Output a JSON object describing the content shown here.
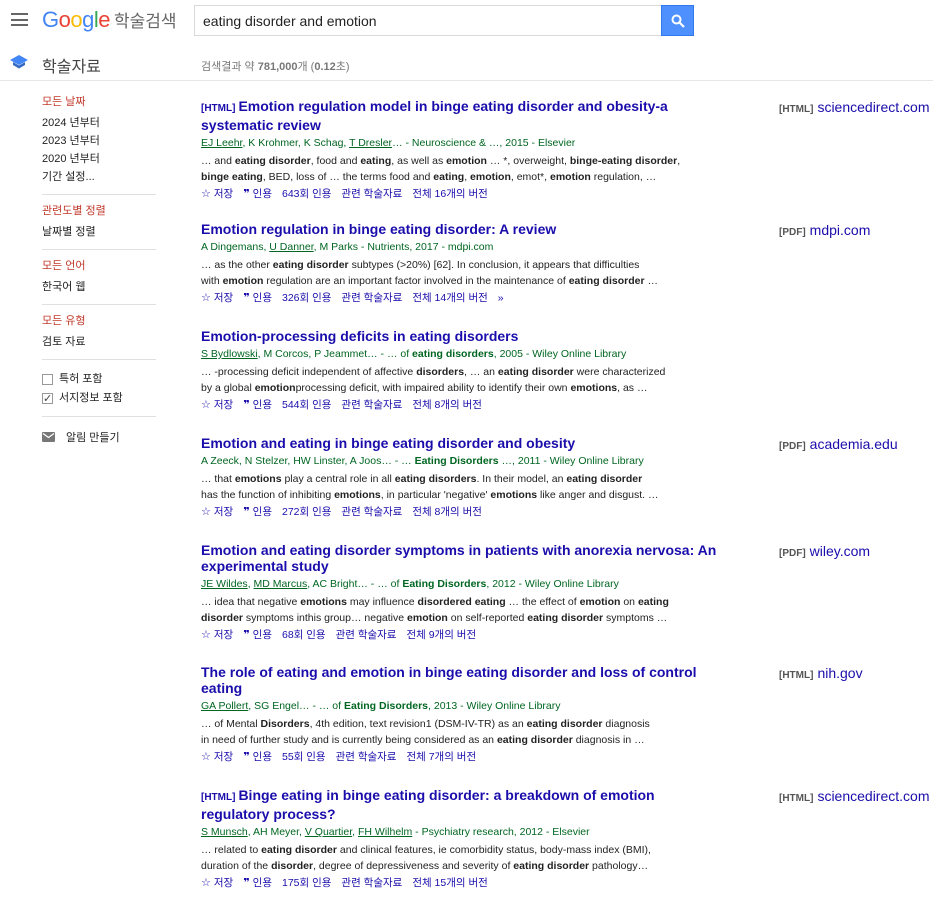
{
  "header": {
    "logo_g": "G",
    "logo_o1": "o",
    "logo_o2": "o",
    "logo_g2": "g",
    "logo_l": "l",
    "logo_e": "e",
    "logo_sub": "학술검색",
    "search_value": "eating disorder and emotion",
    "menu_icon": "hamburger-menu-icon",
    "search_icon": "search-icon",
    "colors": {
      "search_button": "#4d90fe",
      "link": "#1a0dab",
      "source": "#006621",
      "filter_head": "#c0392b"
    }
  },
  "subheader": {
    "title": "학술자료",
    "count_prefix": "검색결과 약 ",
    "count_value": "781,000",
    "count_mid": "개 (",
    "count_time": "0.12",
    "count_suffix": "초)"
  },
  "sidebar": {
    "date_head": "모든 날짜",
    "dates": [
      "2024 년부터",
      "2023 년부터",
      "2020 년부터",
      "기간 설정..."
    ],
    "sort_head": "관련도별 정렬",
    "sort_alt": "날짜별 정렬",
    "lang_head": "모든 언어",
    "lang_alt": "한국어 웹",
    "type_head": "모든 유형",
    "type_alt": "검토 자료",
    "include_patents": "특허 포함",
    "include_citations": "서지정보 포함",
    "include_patents_checked": false,
    "include_citations_checked": true,
    "alert": "알림 만들기"
  },
  "link_labels": {
    "save": "저장",
    "cite": "인용",
    "related": "관련 학술자료"
  },
  "results": [
    {
      "tag": "[HTML]",
      "title": [
        [
          "b",
          "Emotion"
        ],
        [
          "t",
          " regulation model in "
        ],
        [
          "b",
          "binge eating disorder"
        ],
        [
          "t",
          " and obesity-a systematic review"
        ]
      ],
      "meta": [
        [
          "u",
          "EJ Leehr"
        ],
        [
          "t",
          ", K Krohmer, K Schag, "
        ],
        [
          "u",
          "T Dresler"
        ],
        [
          "t",
          "… - Neuroscience & …, 2015 - Elsevier"
        ]
      ],
      "snip1": [
        [
          "t",
          "… and "
        ],
        [
          "b",
          "eating disorder"
        ],
        [
          "t",
          ", food and "
        ],
        [
          "b",
          "eating"
        ],
        [
          "t",
          ", as well as "
        ],
        [
          "b",
          "emotion"
        ],
        [
          "t",
          " … *, overweight, "
        ],
        [
          "b",
          "binge-eating disorder"
        ],
        [
          "t",
          ","
        ]
      ],
      "snip2": [
        [
          "b",
          "binge eating"
        ],
        [
          "t",
          ", BED, loss of … the terms food and "
        ],
        [
          "b",
          "eating"
        ],
        [
          "t",
          ", "
        ],
        [
          "b",
          "emotion"
        ],
        [
          "t",
          ", emot*, "
        ],
        [
          "b",
          "emotion"
        ],
        [
          "t",
          " regulation, …"
        ]
      ],
      "cited": "643회 인용",
      "versions": "전체 16개의 버전",
      "extra": "",
      "side_type": "[HTML]",
      "side_domain": "sciencedirect.com"
    },
    {
      "tag": "",
      "title": [
        [
          "b",
          "Emotion"
        ],
        [
          "t",
          " regulation in "
        ],
        [
          "b",
          "binge eating disorder"
        ],
        [
          "t",
          ": A review"
        ]
      ],
      "meta": [
        [
          "t",
          "A Dingemans, "
        ],
        [
          "u",
          "U Danner"
        ],
        [
          "t",
          ", M Parks - Nutrients, 2017 - mdpi.com"
        ]
      ],
      "snip1": [
        [
          "t",
          "… as the other "
        ],
        [
          "b",
          "eating disorder"
        ],
        [
          "t",
          " subtypes (>20%) [62]. In conclusion, it appears that difficulties"
        ]
      ],
      "snip2": [
        [
          "t",
          "with "
        ],
        [
          "b",
          "emotion"
        ],
        [
          "t",
          " regulation are an important factor involved in the maintenance of "
        ],
        [
          "b",
          "eating disorder"
        ],
        [
          "t",
          " …"
        ]
      ],
      "cited": "326회 인용",
      "versions": "전체 14개의 버전",
      "extra": "»",
      "side_type": "[PDF]",
      "side_domain": "mdpi.com"
    },
    {
      "tag": "",
      "title": [
        [
          "b",
          "Emotion"
        ],
        [
          "t",
          "-processing deficits in "
        ],
        [
          "b",
          "eating disorders"
        ]
      ],
      "meta": [
        [
          "u",
          "S Bydlowski"
        ],
        [
          "t",
          ", M Corcos, P Jeammet… - … of "
        ],
        [
          "b",
          "eating disorders"
        ],
        [
          "t",
          ", 2005 - Wiley Online Library"
        ]
      ],
      "snip1": [
        [
          "t",
          "… -processing deficit independent of affective "
        ],
        [
          "b",
          "disorders"
        ],
        [
          "t",
          ", … an "
        ],
        [
          "b",
          "eating disorder"
        ],
        [
          "t",
          " were characterized"
        ]
      ],
      "snip2": [
        [
          "t",
          "by a global "
        ],
        [
          "b",
          "emotion"
        ],
        [
          "t",
          "processing deficit, with impaired ability to identify their own "
        ],
        [
          "b",
          "emotions"
        ],
        [
          "t",
          ", as …"
        ]
      ],
      "cited": "544회 인용",
      "versions": "전체 8개의 버전",
      "extra": "",
      "side_type": "",
      "side_domain": ""
    },
    {
      "tag": "",
      "title": [
        [
          "b",
          "Emotion"
        ],
        [
          "t",
          " and "
        ],
        [
          "b",
          "eating"
        ],
        [
          "t",
          " in "
        ],
        [
          "b",
          "binge eating disorder"
        ],
        [
          "t",
          " and obesity"
        ]
      ],
      "meta": [
        [
          "t",
          "A Zeeck, N Stelzer, HW Linster, A Joos… - … "
        ],
        [
          "b",
          "Eating Disorders"
        ],
        [
          "t",
          " …, 2011 - Wiley Online Library"
        ]
      ],
      "snip1": [
        [
          "t",
          "… that "
        ],
        [
          "b",
          "emotions"
        ],
        [
          "t",
          " play a central role in all "
        ],
        [
          "b",
          "eating disorders"
        ],
        [
          "t",
          ". In their model, an "
        ],
        [
          "b",
          "eating disorder"
        ]
      ],
      "snip2": [
        [
          "t",
          "has the function of inhibiting "
        ],
        [
          "b",
          "emotions"
        ],
        [
          "t",
          ", in particular 'negative' "
        ],
        [
          "b",
          "emotions"
        ],
        [
          "t",
          " like anger and disgust. …"
        ]
      ],
      "cited": "272회 인용",
      "versions": "전체 8개의 버전",
      "extra": "",
      "side_type": "[PDF]",
      "side_domain": "academia.edu"
    },
    {
      "tag": "",
      "title": [
        [
          "b",
          "Emotion"
        ],
        [
          "t",
          " and "
        ],
        [
          "b",
          "eating disorder"
        ],
        [
          "t",
          " symptoms in patients with anorexia nervosa: An experimental study"
        ]
      ],
      "meta": [
        [
          "u",
          "JE Wildes"
        ],
        [
          "t",
          ", "
        ],
        [
          "u",
          "MD Marcus"
        ],
        [
          "t",
          ", AC Bright… - … of "
        ],
        [
          "b",
          "Eating Disorders"
        ],
        [
          "t",
          ", 2012 - Wiley Online Library"
        ]
      ],
      "snip1": [
        [
          "t",
          "… idea that negative "
        ],
        [
          "b",
          "emotions"
        ],
        [
          "t",
          " may influence "
        ],
        [
          "b",
          "disordered eating"
        ],
        [
          "t",
          " … the effect of "
        ],
        [
          "b",
          "emotion"
        ],
        [
          "t",
          " on "
        ],
        [
          "b",
          "eating"
        ]
      ],
      "snip2": [
        [
          "b",
          "disorder"
        ],
        [
          "t",
          " symptoms inthis group… negative "
        ],
        [
          "b",
          "emotion"
        ],
        [
          "t",
          " on self-reported "
        ],
        [
          "b",
          "eating disorder"
        ],
        [
          "t",
          " symptoms …"
        ]
      ],
      "cited": "68회 인용",
      "versions": "전체 9개의 버전",
      "extra": "",
      "side_type": "[PDF]",
      "side_domain": "wiley.com"
    },
    {
      "tag": "",
      "title": [
        [
          "t",
          "The role of "
        ],
        [
          "b",
          "eating"
        ],
        [
          "t",
          " and "
        ],
        [
          "b",
          "emotion"
        ],
        [
          "t",
          " in "
        ],
        [
          "b",
          "binge eating disorder"
        ],
        [
          "t",
          " and loss of control "
        ],
        [
          "b",
          "eating"
        ]
      ],
      "meta": [
        [
          "u",
          "GA Pollert"
        ],
        [
          "t",
          ", SG Engel… - … of "
        ],
        [
          "b",
          "Eating Disorders"
        ],
        [
          "t",
          ", 2013 - Wiley Online Library"
        ]
      ],
      "snip1": [
        [
          "t",
          "… of Mental "
        ],
        [
          "b",
          "Disorders"
        ],
        [
          "t",
          ", 4th edition, text revision1 (DSM-IV-TR) as an "
        ],
        [
          "b",
          "eating disorder"
        ],
        [
          "t",
          " diagnosis"
        ]
      ],
      "snip2": [
        [
          "t",
          "in need of further study and is currently being considered as an "
        ],
        [
          "b",
          "eating disorder"
        ],
        [
          "t",
          " diagnosis in …"
        ]
      ],
      "cited": "55회 인용",
      "versions": "전체 7개의 버전",
      "extra": "",
      "side_type": "[HTML]",
      "side_domain": "nih.gov"
    },
    {
      "tag": "[HTML]",
      "title": [
        [
          "b",
          "Binge eating"
        ],
        [
          "t",
          " in "
        ],
        [
          "b",
          "binge eating disorder"
        ],
        [
          "t",
          ": a breakdown of "
        ],
        [
          "b",
          "emotion"
        ],
        [
          "t",
          " regulatory process?"
        ]
      ],
      "meta": [
        [
          "u",
          "S Munsch"
        ],
        [
          "t",
          ", AH Meyer, "
        ],
        [
          "u",
          "V Quartier"
        ],
        [
          "t",
          ", "
        ],
        [
          "u",
          "FH Wilhelm"
        ],
        [
          "t",
          " - Psychiatry research, 2012 - Elsevier"
        ]
      ],
      "snip1": [
        [
          "t",
          "… related to "
        ],
        [
          "b",
          "eating disorder"
        ],
        [
          "t",
          " and clinical features, ie comorbidity status, body-mass index (BMI),"
        ]
      ],
      "snip2": [
        [
          "t",
          "duration of the "
        ],
        [
          "b",
          "disorder"
        ],
        [
          "t",
          ", degree of depressiveness and severity of "
        ],
        [
          "b",
          "eating disorder"
        ],
        [
          "t",
          " pathology…"
        ]
      ],
      "cited": "175회 인용",
      "versions": "전체 15개의 버전",
      "extra": "",
      "side_type": "[HTML]",
      "side_domain": "sciencedirect.com"
    }
  ]
}
